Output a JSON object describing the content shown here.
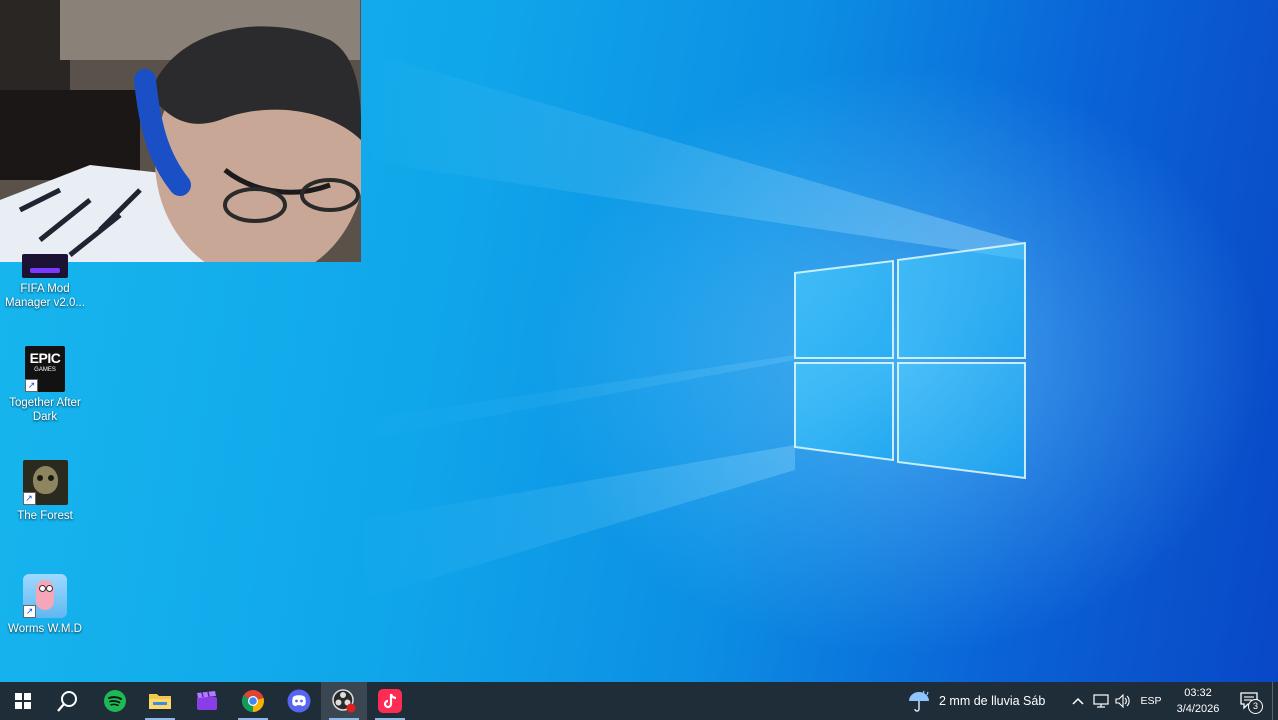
{
  "desktop": {
    "icons": [
      {
        "label": "FIFA Mod Manager v2.0...",
        "icon": "fifa-mod-manager-icon"
      },
      {
        "label": "Together After Dark",
        "icon": "epic-games-icon",
        "badge": "EPIC GAMES"
      },
      {
        "label": "The Forest",
        "icon": "the-forest-icon"
      },
      {
        "label": "Worms W.M.D",
        "icon": "worms-wmd-icon"
      }
    ]
  },
  "taskbar": {
    "apps": [
      {
        "name": "start",
        "icon": "windows-start-icon"
      },
      {
        "name": "search",
        "icon": "search-icon"
      },
      {
        "name": "spotify",
        "icon": "spotify-icon"
      },
      {
        "name": "file-explorer",
        "icon": "folder-icon"
      },
      {
        "name": "clapperboard",
        "icon": "clapperboard-icon"
      },
      {
        "name": "chrome",
        "icon": "chrome-icon"
      },
      {
        "name": "discord",
        "icon": "discord-icon"
      },
      {
        "name": "obs",
        "icon": "obs-record-icon"
      },
      {
        "name": "tiktok",
        "icon": "tiktok-icon"
      }
    ],
    "weather": "2 mm de lluvia Sáb",
    "language": "ESP",
    "time": "03:32",
    "date": "3/4/2026",
    "notifications": "3"
  },
  "colors": {
    "taskbar": "#1f2d39",
    "desktop_blue": "#0c8fe4",
    "spotify": "#1db954",
    "discord": "#5865f2",
    "tiktok": "#fe2c55"
  }
}
